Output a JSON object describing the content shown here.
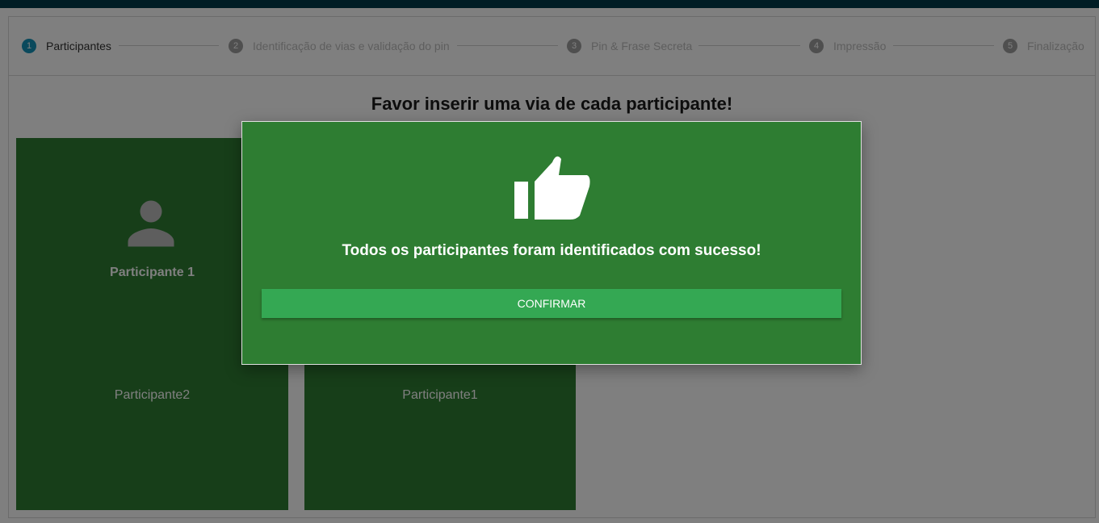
{
  "stepper": {
    "steps": [
      {
        "number": "1",
        "label": "Participantes",
        "active": true
      },
      {
        "number": "2",
        "label": "Identificação de vias e validação do pin",
        "active": false
      },
      {
        "number": "3",
        "label": "Pin & Frase Secreta",
        "active": false
      },
      {
        "number": "4",
        "label": "Impressão",
        "active": false
      },
      {
        "number": "5",
        "label": "Finalização",
        "active": false
      }
    ]
  },
  "main": {
    "heading": "Favor inserir uma via de cada participante!",
    "cards": [
      {
        "title": "Participante 1",
        "footer": "Participante2",
        "icon": "person-icon"
      },
      {
        "title": "",
        "footer": "Participante1",
        "icon": "person-icon"
      }
    ]
  },
  "modal": {
    "icon": "thumbs-up-icon",
    "message": "Todos os participantes foram identificados com sucesso!",
    "confirm_label": "CONFIRMAR"
  },
  "colors": {
    "topbar": "#003a4a",
    "active_step": "#1592b8",
    "card_green": "#2e7d32",
    "button_green": "#34a853"
  }
}
